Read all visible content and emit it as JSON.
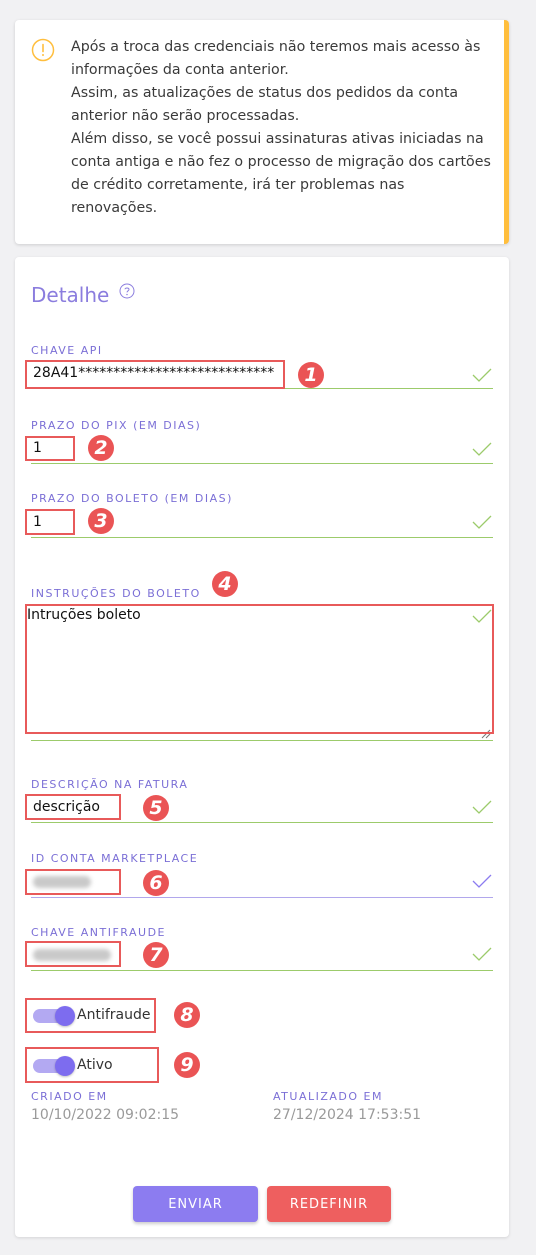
{
  "alert": {
    "lines": [
      "Após a troca das credenciais não teremos mais acesso às informações da conta anterior.",
      "Assim, as atualizações de status dos pedidos da conta anterior não serão processadas.",
      "Além disso, se você possui assinaturas ativas iniciadas na conta antiga e não fez o processo de migração dos cartões de crédito corretamente, irá ter problemas nas renovações."
    ]
  },
  "detail": {
    "title": "Detalhe",
    "fields": {
      "api_key": {
        "label": "CHAVE API",
        "value": "28A41****************************"
      },
      "pix_days": {
        "label": "PRAZO DO PIX (EM DIAS)",
        "value": "1"
      },
      "boleto_days": {
        "label": "PRAZO DO BOLETO (EM DIAS)",
        "value": "1"
      },
      "boleto_instructions": {
        "label": "INSTRUÇÕES DO BOLETO",
        "value": "Intruções boleto"
      },
      "invoice_description": {
        "label": "DESCRIÇÃO NA FATURA",
        "value": "descrição"
      },
      "marketplace_id": {
        "label": "ID CONTA MARKETPLACE"
      },
      "antifraud_key": {
        "label": "CHAVE ANTIFRAUDE"
      }
    },
    "toggles": {
      "antifraud": {
        "label": "Antifraude",
        "on": true
      },
      "active": {
        "label": "Ativo",
        "on": true
      }
    },
    "meta": {
      "created_label": "CRIADO EM",
      "created_value": "10/10/2022 09:02:15",
      "updated_label": "ATUALIZADO EM",
      "updated_value": "27/12/2024 17:53:51"
    },
    "buttons": {
      "submit": "ENVIAR",
      "reset": "REDEFINIR"
    }
  },
  "annotations": [
    "1",
    "2",
    "3",
    "4",
    "5",
    "6",
    "7",
    "8",
    "9"
  ],
  "colors": {
    "accent": "#8c7cf0",
    "danger": "#ee5f5f",
    "warning": "#ffbe3d",
    "valid": "#9ccb6b"
  },
  "icons": [
    "alert-circle-icon",
    "help-circle-icon",
    "check-icon"
  ]
}
